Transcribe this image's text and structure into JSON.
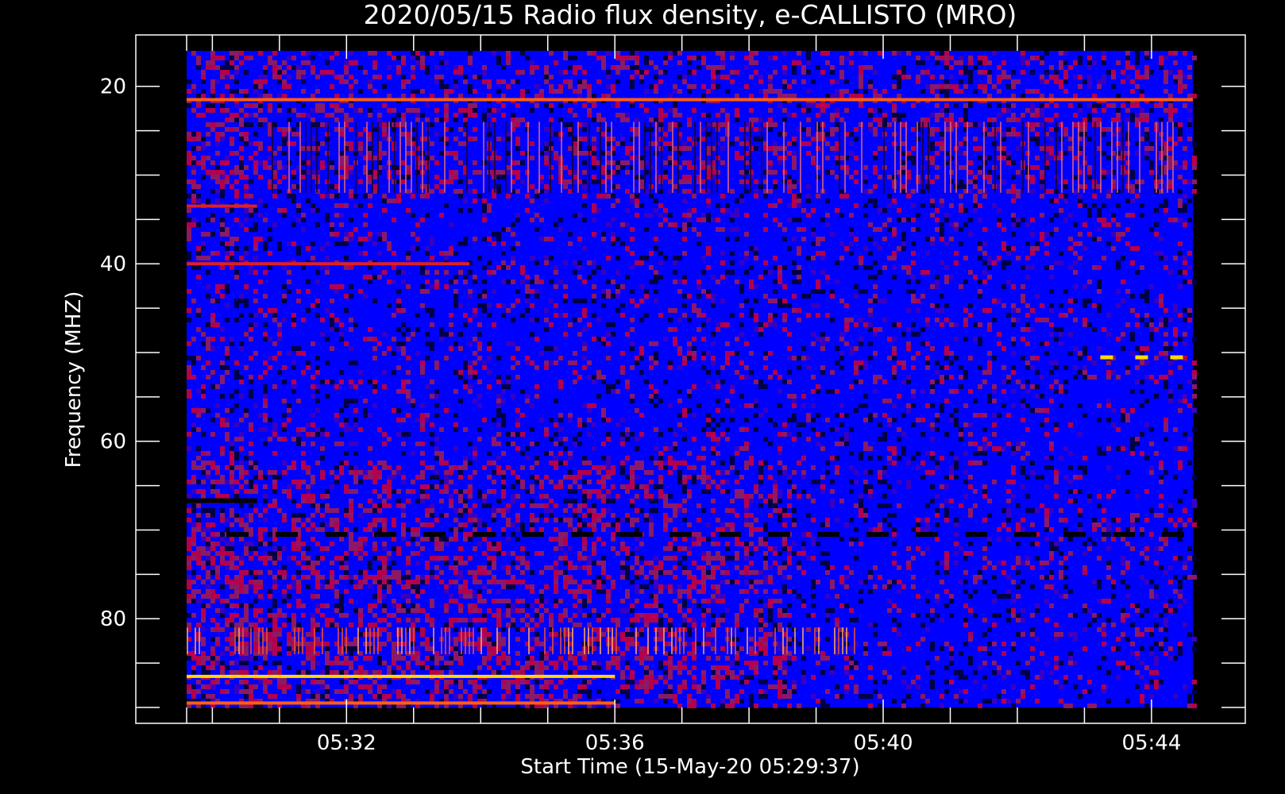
{
  "chart_data": {
    "type": "heatmap",
    "title": "2020/05/15  Radio flux density, e-CALLISTO (MRO)",
    "xlabel": "Start Time (15-May-20 05:29:37)",
    "ylabel": "Frequency (MHZ)",
    "y_inverted": true,
    "xlim": [
      "05:29:37",
      "05:44:37"
    ],
    "ylim": [
      16,
      90
    ],
    "x_ticks": [
      "05:32",
      "05:36",
      "05:40",
      "05:44"
    ],
    "y_ticks": [
      20,
      40,
      60,
      80
    ],
    "colormap": [
      "#000000",
      "#0000ff",
      "#ff0000",
      "#ffff00"
    ],
    "background": "#0000ff",
    "features": [
      {
        "kind": "bright-band",
        "freq_mhz": 21.5,
        "from": "05:29:37",
        "to": "05:44:37",
        "intensity": "red-yellow"
      },
      {
        "kind": "bright-band",
        "freq_mhz": 33.5,
        "from": "05:29:37",
        "to": "05:30:40",
        "intensity": "red"
      },
      {
        "kind": "bright-band",
        "freq_mhz": 40.0,
        "from": "05:29:37",
        "to": "05:33:50",
        "intensity": "red"
      },
      {
        "kind": "dark-band",
        "freq_mhz": 66.7,
        "from": "05:29:37",
        "to": "05:30:40"
      },
      {
        "kind": "dashed-dark-band",
        "freq_mhz": 70.5,
        "from": "05:29:37",
        "to": "05:44:37"
      },
      {
        "kind": "dashed-bright-band",
        "freq_mhz": 50.5,
        "from": "05:43:00",
        "to": "05:44:37",
        "intensity": "yellow"
      },
      {
        "kind": "bright-band",
        "freq_mhz": 86.5,
        "from": "05:29:37",
        "to": "05:36:00",
        "intensity": "yellow"
      },
      {
        "kind": "bright-band",
        "freq_mhz": 89.5,
        "from": "05:29:37",
        "to": "05:36:00",
        "intensity": "red-yellow"
      }
    ]
  }
}
